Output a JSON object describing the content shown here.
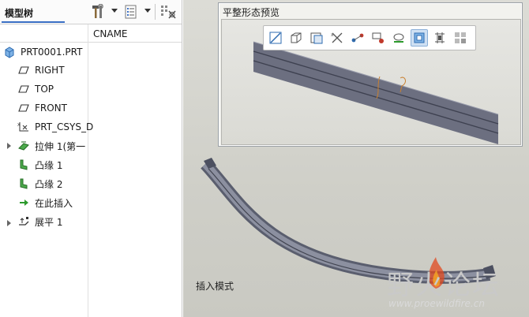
{
  "model_tree": {
    "title": "模型树",
    "column_header": "CNAME",
    "items": [
      {
        "label": "PRT0001.PRT",
        "icon": "part-icon"
      },
      {
        "label": "RIGHT",
        "icon": "datum-plane-icon"
      },
      {
        "label": "TOP",
        "icon": "datum-plane-icon"
      },
      {
        "label": "FRONT",
        "icon": "datum-plane-icon"
      },
      {
        "label": "PRT_CSYS_D",
        "icon": "csys-icon"
      },
      {
        "label": "拉伸 1(第一",
        "icon": "extrude-wall-icon"
      },
      {
        "label": "凸缘 1",
        "icon": "flange-icon"
      },
      {
        "label": "凸缘 2",
        "icon": "flange-icon"
      },
      {
        "label": "在此插入",
        "icon": "insert-here-arrow-icon"
      },
      {
        "label": "展平 1",
        "icon": "unbend-icon"
      }
    ]
  },
  "preview": {
    "title": "平整形态预览",
    "toolbar_icons": [
      "refit-icon",
      "view-orientation-icon",
      "saved-views-icon",
      "datum-display-icon",
      "datum-axis-icon",
      "spin-center-icon",
      "annotation-display-icon",
      "display-style-icon",
      "shaded-icon",
      "layer-icon"
    ]
  },
  "status_text": "插入模式",
  "watermark": {
    "name": "野火论坛",
    "url": "www.proewildfire.cn"
  },
  "colors": {
    "accent": "#3b6fc4",
    "viewport_bg": "#d0d0ca",
    "sheet_metal": "#6c6f80",
    "watermark_flame": "#e24a1f"
  }
}
